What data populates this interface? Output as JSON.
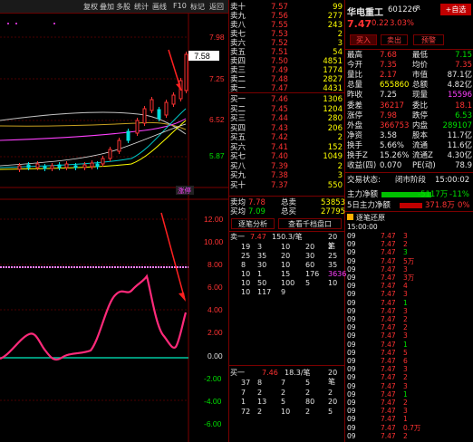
{
  "toolbar": {
    "buttons": [
      "复权",
      "叠加",
      "多股",
      "统计",
      "画线",
      "F10",
      "标记",
      "返回"
    ]
  },
  "chart": {
    "price_axis": [
      "7.98",
      "7.25",
      "6.52",
      "5.87"
    ],
    "current_price_tag": "7.58",
    "limit_up_label": "涨停",
    "indicator_axis": [
      "12.00",
      "10.00",
      "8.00",
      "6.00",
      "4.00",
      "2.00",
      "0.00",
      "-2.00",
      "-4.00",
      "-6.00"
    ]
  },
  "orderbook": {
    "asks": [
      {
        "label": "卖十",
        "price": "7.57",
        "vol": "99"
      },
      {
        "label": "卖九",
        "price": "7.56",
        "vol": "277"
      },
      {
        "label": "卖八",
        "price": "7.55",
        "vol": "243"
      },
      {
        "label": "卖七",
        "price": "7.53",
        "vol": "2"
      },
      {
        "label": "卖六",
        "price": "7.52",
        "vol": "3"
      },
      {
        "label": "卖五",
        "price": "7.51",
        "vol": "54"
      },
      {
        "label": "卖四",
        "price": "7.50",
        "vol": "4851"
      },
      {
        "label": "卖三",
        "price": "7.49",
        "vol": "1774"
      },
      {
        "label": "卖二",
        "price": "7.48",
        "vol": "2827"
      },
      {
        "label": "卖一",
        "price": "7.47",
        "vol": "4431"
      }
    ],
    "bids": [
      {
        "label": "买一",
        "price": "7.46",
        "vol": "1306"
      },
      {
        "label": "买二",
        "price": "7.45",
        "vol": "1204"
      },
      {
        "label": "买三",
        "price": "7.44",
        "vol": "280"
      },
      {
        "label": "买四",
        "price": "7.43",
        "vol": "206"
      },
      {
        "label": "买五",
        "price": "7.42",
        "vol": "2"
      },
      {
        "label": "买六",
        "price": "7.41",
        "vol": "152"
      },
      {
        "label": "买七",
        "price": "7.40",
        "vol": "1049"
      },
      {
        "label": "买八",
        "price": "7.39",
        "vol": "2"
      },
      {
        "label": "买九",
        "price": "7.38",
        "vol": "3"
      },
      {
        "label": "买十",
        "price": "7.37",
        "vol": "550"
      }
    ],
    "summary": [
      {
        "l1": "卖均",
        "v1": "7.78",
        "l2": "总卖",
        "v2": "53853"
      },
      {
        "l1": "买均",
        "v1": "7.09",
        "l2": "总买",
        "v2": "27795"
      }
    ],
    "buttons": [
      "逐笔分析",
      "查看千档盘口"
    ]
  },
  "queue_sell": {
    "title": "卖一",
    "price": "7.47",
    "info": "150.3/笔",
    "count": "20笔",
    "rows": [
      [
        "19",
        "3",
        "10",
        "20",
        "2"
      ],
      [
        "25",
        "35",
        "20",
        "30",
        "25"
      ],
      [
        "8",
        "30",
        "10",
        "60",
        "35"
      ],
      [
        "10",
        "1",
        "15",
        "176",
        "3636"
      ],
      [
        "10",
        "50",
        "100",
        "5",
        "10"
      ],
      [
        "10",
        "117",
        "9",
        "",
        ""
      ]
    ]
  },
  "queue_buy": {
    "title": "买一",
    "price": "7.46",
    "info": "18.3/笔",
    "count": "20笔",
    "rows": [
      [
        "37",
        "8",
        "7",
        "5",
        ""
      ],
      [
        "7",
        "2",
        "2",
        "2",
        "2"
      ],
      [
        "1",
        "13",
        "5",
        "80",
        "20"
      ],
      [
        "72",
        "2",
        "10",
        "2",
        "5"
      ]
    ]
  },
  "quote": {
    "name": "华电重工",
    "code": "601226",
    "badge": "R",
    "add_btn": "+自选",
    "price": "7.47",
    "change": "0.22",
    "pct": "3.03%",
    "buy_btn": "买入",
    "sell_btn": "卖出",
    "warn_btn": "预警",
    "rows": [
      {
        "l1": "最高",
        "v1": "7.68",
        "l2": "最低",
        "v2": "7.15"
      },
      {
        "l1": "今开",
        "v1": "7.35",
        "l2": "均价",
        "v2": "7.35"
      },
      {
        "l1": "量比",
        "v1": "2.17",
        "l2": "市值",
        "v2": "87.1亿"
      },
      {
        "l1": "总量",
        "v1": "655860",
        "l2": "总额",
        "v2": "4.82亿"
      },
      {
        "l1": "昨收",
        "v1": "7.25",
        "l2": "现量",
        "v2": "15596"
      },
      {
        "l1": "委差",
        "v1": "36217",
        "l2": "委比",
        "v2": "18.1"
      },
      {
        "l1": "涨停",
        "v1": "7.98",
        "l2": "跌停",
        "v2": "6.53"
      },
      {
        "l1": "外盘",
        "v1": "366753",
        "l2": "内盘",
        "v2": "289107"
      },
      {
        "l1": "净资",
        "v1": "3.58",
        "l2": "股本",
        "v2": "11.7亿"
      },
      {
        "l1": "换手",
        "v1": "5.66%",
        "l2": "流通",
        "v2": "11.6亿"
      },
      {
        "l1": "换手Z",
        "v1": "15.26%",
        "l2": "流通Z",
        "v2": "4.30亿"
      },
      {
        "l1": "收益(四)",
        "v1": "0.070",
        "l2": "PE(动)",
        "v2": "78.9"
      }
    ],
    "status_label": "交易状态:",
    "status_value": "闭市阶段",
    "status_time": "15:00:02",
    "main_flow_label": "主力净额",
    "main_flow_value": "-5117万",
    "main_flow_pct": "-11%",
    "flow5_label": "5日主力净额",
    "flow5_value": "371.8万",
    "flow5_pct": "0%"
  },
  "ticks": {
    "header_time": "15:00:00",
    "header_title": "逐笔还原",
    "rows": [
      {
        "t": "09",
        "p": "7.47",
        "v": "3",
        "c": "r"
      },
      {
        "t": "09",
        "p": "7.47",
        "v": "2",
        "c": "r"
      },
      {
        "t": "09",
        "p": "7.47",
        "v": "3",
        "c": "g"
      },
      {
        "t": "09",
        "p": "7.47",
        "v": "5万",
        "c": "r"
      },
      {
        "t": "09",
        "p": "7.47",
        "v": "3",
        "c": "r"
      },
      {
        "t": "09",
        "p": "7.47",
        "v": "3万",
        "c": "r"
      },
      {
        "t": "09",
        "p": "7.47",
        "v": "4",
        "c": "r"
      },
      {
        "t": "09",
        "p": "7.47",
        "v": "3",
        "c": "r"
      },
      {
        "t": "09",
        "p": "7.47",
        "v": "1",
        "c": "g"
      },
      {
        "t": "09",
        "p": "7.47",
        "v": "3",
        "c": "r"
      },
      {
        "t": "09",
        "p": "7.47",
        "v": "2",
        "c": "r"
      },
      {
        "t": "09",
        "p": "7.47",
        "v": "2",
        "c": "r"
      },
      {
        "t": "09",
        "p": "7.47",
        "v": "3",
        "c": "r"
      },
      {
        "t": "09",
        "p": "7.47",
        "v": "1",
        "c": "g"
      },
      {
        "t": "09",
        "p": "7.47",
        "v": "5",
        "c": "r"
      },
      {
        "t": "09",
        "p": "7.47",
        "v": "6",
        "c": "r"
      },
      {
        "t": "09",
        "p": "7.47",
        "v": "3",
        "c": "r"
      },
      {
        "t": "09",
        "p": "7.47",
        "v": "2",
        "c": "r"
      },
      {
        "t": "09",
        "p": "7.47",
        "v": "3",
        "c": "r"
      },
      {
        "t": "09",
        "p": "7.47",
        "v": "1",
        "c": "g"
      },
      {
        "t": "09",
        "p": "7.47",
        "v": "2",
        "c": "r"
      },
      {
        "t": "09",
        "p": "7.47",
        "v": "3",
        "c": "r"
      },
      {
        "t": "09",
        "p": "7.47",
        "v": "1",
        "c": "r"
      },
      {
        "t": "09",
        "p": "7.47",
        "v": "0.7万",
        "c": "r"
      },
      {
        "t": "09",
        "p": "7.47",
        "v": "2",
        "c": "r"
      }
    ]
  }
}
